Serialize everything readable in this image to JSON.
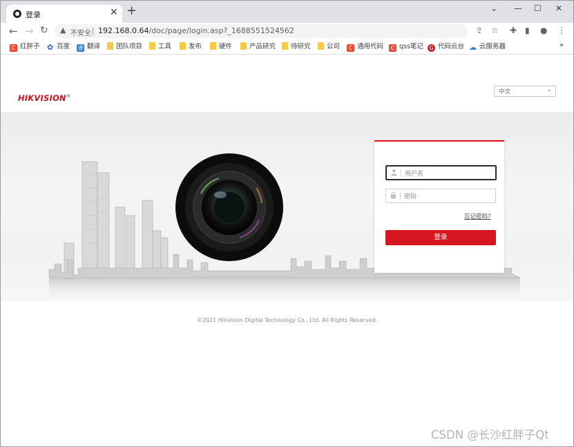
{
  "browser": {
    "tab_title": "登录",
    "url_insecure_label": "不安全",
    "url_host": "192.168.0.64",
    "url_path": "/doc/page/login.asp?_1688551524562",
    "bookmarks": [
      {
        "label": "红胖子",
        "icon": "c-icon"
      },
      {
        "label": "百度",
        "icon": "baidu-paw-icon"
      },
      {
        "label": "翻译",
        "icon": "translate-icon"
      },
      {
        "label": "团队项目",
        "icon": "folder-icon"
      },
      {
        "label": "工具",
        "icon": "folder-icon"
      },
      {
        "label": "发布",
        "icon": "folder-icon"
      },
      {
        "label": "硬件",
        "icon": "folder-icon"
      },
      {
        "label": "产品研究",
        "icon": "folder-icon"
      },
      {
        "label": "待研究",
        "icon": "folder-icon"
      },
      {
        "label": "公司",
        "icon": "folder-icon"
      },
      {
        "label": "通用代码",
        "icon": "c-icon"
      },
      {
        "label": "qss笔记",
        "icon": "c-icon"
      },
      {
        "label": "代码云台",
        "icon": "gitee-icon"
      },
      {
        "label": "云服务器",
        "icon": "cloud-icon"
      }
    ],
    "bookmarks_more": "»"
  },
  "page": {
    "logo": {
      "brand": "HIKVISION",
      "mark": "®"
    },
    "language_select": {
      "value": "中文"
    },
    "login": {
      "username_placeholder": "用户名",
      "password_placeholder": "密码",
      "forgot_link": "忘记密码?",
      "login_button": "登录"
    },
    "footer": "©2021 Hikvision Digital Technology Co., Ltd. All Rights Reserved."
  },
  "watermark": "CSDN @长沙红胖子Qt",
  "colors": {
    "brand_red": "#d6171f",
    "logo_red": "#c8141d"
  }
}
